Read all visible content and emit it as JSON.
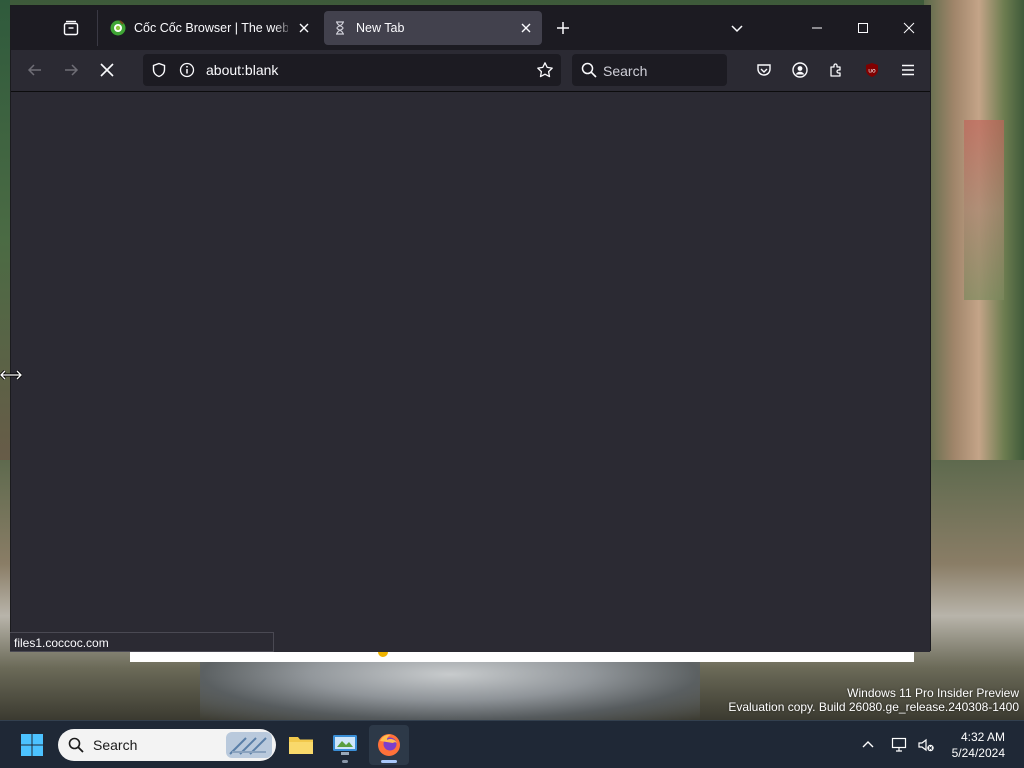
{
  "browser": {
    "tabs": [
      {
        "title": "Cốc Cốc Browser | The web bro",
        "icon": "coccoc-favicon-icon",
        "active": false
      },
      {
        "title": "New Tab",
        "icon": "hourglass-icon",
        "active": true
      }
    ],
    "url": "about:blank",
    "search_placeholder": "Search",
    "status_text": "files1.coccoc.com"
  },
  "desktop": {
    "watermark_line1": "Windows 11 Pro Insider Preview",
    "watermark_line2": "Evaluation copy. Build 26080.ge_release.240308-1400"
  },
  "taskbar": {
    "search_placeholder": "Search",
    "time": "4:32 AM",
    "date": "5/24/2024"
  },
  "colors": {
    "window_bg": "#2b2a33",
    "tabbar_bg": "#1c1b22",
    "active_tab": "#42414d",
    "taskbar_bg": "#1f2836",
    "ublock_red": "#800000"
  }
}
